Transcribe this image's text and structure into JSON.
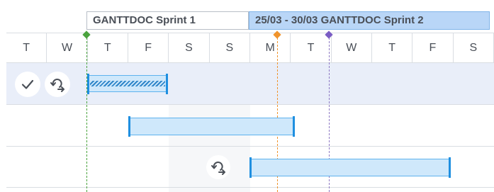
{
  "timeline": {
    "sprints": [
      {
        "label": "GANTTDOC Sprint 1"
      },
      {
        "label": "25/03 - 30/03 GANTTDOC Sprint 2"
      }
    ],
    "days": [
      "T",
      "W",
      "T",
      "F",
      "S",
      "S",
      "M",
      "T",
      "W",
      "T",
      "F",
      "S"
    ]
  },
  "rows": [
    {
      "selected": true,
      "actions": [
        "check-icon",
        "repeat-icon"
      ],
      "task_bar": {
        "progress": 1.0,
        "style": "striped"
      }
    },
    {
      "selected": false,
      "task_bar": {
        "progress": 0
      }
    },
    {
      "selected": false,
      "actions": [
        "repeat-icon"
      ],
      "task_bar": {
        "progress": 0
      }
    }
  ],
  "markers": [
    {
      "name": "sprint-1-start",
      "color": "#4aa33d"
    },
    {
      "name": "today",
      "color": "#f0932b"
    },
    {
      "name": "milestone",
      "color": "#7a5cc4"
    }
  ],
  "colors": {
    "sprint_active": "#b9d6f7",
    "bar_fill": "#cfe8fb",
    "bar_edge": "#1f8fe0",
    "row_selected": "#e9eef9"
  }
}
